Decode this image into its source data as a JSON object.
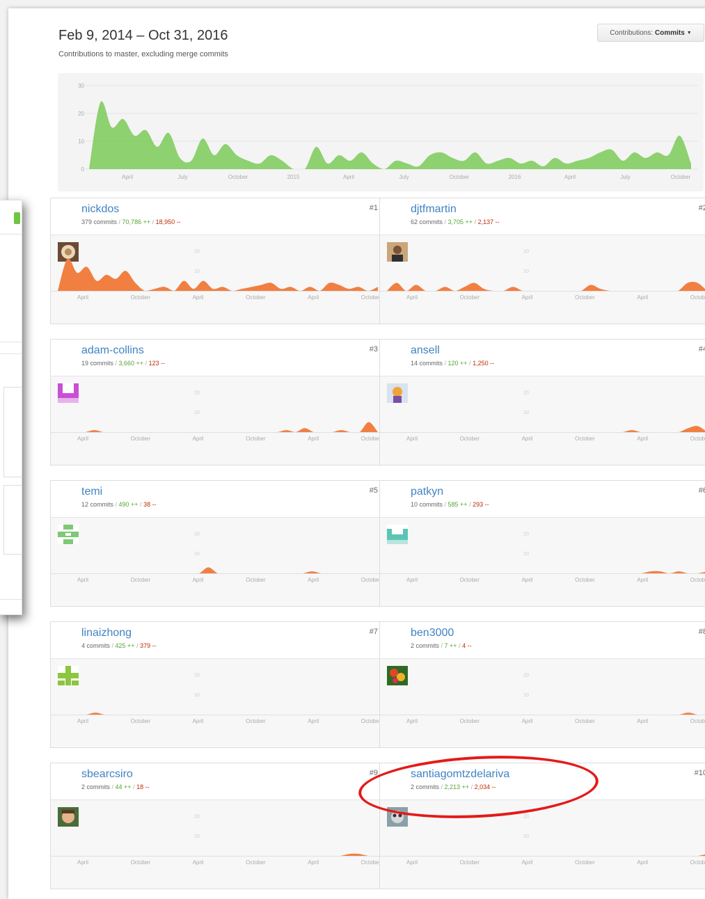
{
  "header": {
    "date_range": "Feb 9, 2014 – Oct 31, 2016",
    "subtitle": "Contributions to master, excluding merge commits",
    "contrib_prefix": "Contributions:",
    "contrib_value": "Commits"
  },
  "colors": {
    "main_area": "#6cc644",
    "user_area": "#f17f42",
    "link": "#4183c4",
    "additions": "#55a532",
    "deletions": "#bd2c00",
    "highlight": "#e41a1a"
  },
  "chart_data": [
    {
      "type": "area",
      "name": "all-contributors",
      "y_ticks": [
        0,
        10,
        20,
        30
      ],
      "ylim": [
        0,
        30
      ],
      "x_labels": [
        "April",
        "July",
        "October",
        "2015",
        "April",
        "July",
        "October",
        "2016",
        "April",
        "July",
        "October"
      ],
      "values": [
        0,
        24,
        15,
        18,
        12,
        14,
        8,
        13,
        4,
        3,
        11,
        5,
        9,
        5,
        3,
        2,
        5,
        3,
        0,
        0,
        8,
        2,
        5,
        3,
        6,
        2,
        0,
        3,
        2,
        1,
        5,
        6,
        4,
        3,
        6,
        2,
        3,
        4,
        2,
        3,
        1,
        4,
        2,
        3,
        4,
        6,
        7,
        3,
        6,
        4,
        6,
        5,
        12,
        2
      ]
    },
    {
      "type": "area",
      "name": "user-chart",
      "y_ticks": [
        10,
        20
      ],
      "x_labels": [
        "April",
        "October",
        "April",
        "October",
        "April",
        "October"
      ]
    }
  ],
  "users": [
    {
      "rank": "#1",
      "name": "nickdos",
      "commits": "379 commits",
      "additions": "70,786 ++",
      "deletions": "18,950 --",
      "avatar": "latte",
      "values": [
        0,
        16,
        9,
        12,
        5,
        8,
        6,
        10,
        4,
        0,
        1,
        2,
        0,
        5,
        1,
        5,
        1,
        2,
        0,
        1,
        2,
        3,
        4,
        1,
        2,
        0,
        2,
        0,
        4,
        3,
        1,
        2,
        0,
        2
      ]
    },
    {
      "rank": "#2",
      "name": "djtfmartin",
      "commits": "62 commits",
      "additions": "3,705 ++",
      "deletions": "2,137 --",
      "avatar": "photo-man",
      "values": [
        0,
        4,
        0,
        3,
        0,
        0,
        2,
        0,
        2,
        4,
        1,
        0,
        0,
        2,
        0,
        0,
        0,
        0,
        0,
        0,
        0,
        3,
        1,
        0,
        0,
        0,
        0,
        0,
        0,
        0,
        0,
        4,
        4,
        0
      ]
    },
    {
      "rank": "#3",
      "name": "adam-collins",
      "commits": "19 commits",
      "additions": "3,660 ++",
      "deletions": "123 --",
      "avatar": "magenta-identicon",
      "values": [
        0,
        0,
        0,
        0,
        1,
        0,
        0,
        0,
        0,
        0,
        0,
        0,
        0,
        0,
        0,
        0,
        0,
        0,
        0,
        0,
        0,
        0,
        0,
        0,
        0,
        1,
        0,
        2,
        0,
        0,
        0,
        1,
        0,
        0,
        5,
        0
      ]
    },
    {
      "rank": "#4",
      "name": "ansell",
      "commits": "14 commits",
      "additions": "120 ++",
      "deletions": "1,250 --",
      "avatar": "cartoon",
      "values": [
        0,
        0,
        0,
        0,
        0,
        0,
        0,
        0,
        0,
        0,
        0,
        0,
        0,
        0,
        0,
        0,
        0,
        0,
        0,
        0,
        0,
        0,
        0,
        0,
        0,
        0,
        1,
        0,
        0,
        0,
        0,
        0,
        2,
        3,
        0
      ]
    },
    {
      "rank": "#5",
      "name": "temi",
      "commits": "12 commits",
      "additions": "490 ++",
      "deletions": "38 --",
      "avatar": "green-identicon",
      "values": [
        0,
        0,
        0,
        0,
        0,
        0,
        0,
        0,
        0,
        0,
        0,
        0,
        0,
        0,
        0,
        0,
        3,
        0,
        0,
        0,
        0,
        0,
        0,
        0,
        0,
        0,
        0,
        1,
        0,
        0,
        0,
        0,
        0,
        0,
        0
      ]
    },
    {
      "rank": "#6",
      "name": "patkyn",
      "commits": "10 commits",
      "additions": "585 ++",
      "deletions": "293 --",
      "avatar": "teal-identicon",
      "values": [
        0,
        0,
        0,
        0,
        0,
        0,
        0,
        0,
        0,
        0,
        0,
        0,
        0,
        0,
        0,
        0,
        0,
        0,
        0,
        0,
        0,
        0,
        0,
        0,
        0,
        0,
        0,
        0,
        1,
        1,
        0,
        1,
        0,
        0,
        1
      ]
    },
    {
      "rank": "#7",
      "name": "linaizhong",
      "commits": "4 commits",
      "additions": "425 ++",
      "deletions": "379 --",
      "avatar": "lime-identicon",
      "values": [
        0,
        0,
        0,
        0,
        1,
        0,
        0,
        0,
        0,
        0,
        0,
        0,
        0,
        0,
        0,
        0,
        0,
        0,
        0,
        0,
        0,
        0,
        0,
        0,
        0,
        0,
        0,
        0,
        0,
        0,
        0,
        0,
        0,
        0,
        0
      ]
    },
    {
      "rank": "#8",
      "name": "ben3000",
      "commits": "2 commits",
      "additions": "7 ++",
      "deletions": "4 --",
      "avatar": "flower",
      "values": [
        0,
        0,
        0,
        0,
        0,
        0,
        0,
        0,
        0,
        0,
        0,
        0,
        0,
        0,
        0,
        0,
        0,
        0,
        0,
        0,
        0,
        0,
        0,
        0,
        0,
        0,
        0,
        0,
        0,
        0,
        0,
        0,
        1,
        0,
        0
      ]
    },
    {
      "rank": "#9",
      "name": "sbearcsiro",
      "commits": "2 commits",
      "additions": "44 ++",
      "deletions": "18 --",
      "avatar": "photo-boy",
      "values": [
        0,
        0,
        0,
        0,
        0,
        0,
        0,
        0,
        0,
        0,
        0,
        0,
        0,
        0,
        0,
        0,
        0,
        0,
        0,
        0,
        0,
        0,
        0,
        0,
        0,
        0,
        0,
        0,
        0,
        0,
        0,
        1,
        1,
        0,
        0
      ]
    },
    {
      "rank": "#10",
      "name": "santiagomtzdelariva",
      "commits": "2 commits",
      "additions": "2,213 ++",
      "deletions": "2,034 --",
      "avatar": "lemur",
      "values": [
        0,
        0,
        0,
        0,
        0,
        0,
        0,
        0,
        0,
        0,
        0,
        0,
        0,
        0,
        0,
        0,
        0,
        0,
        0,
        0,
        0,
        0,
        0,
        0,
        0,
        0,
        0,
        0,
        0,
        0,
        0,
        0,
        0,
        0,
        1
      ]
    }
  ]
}
